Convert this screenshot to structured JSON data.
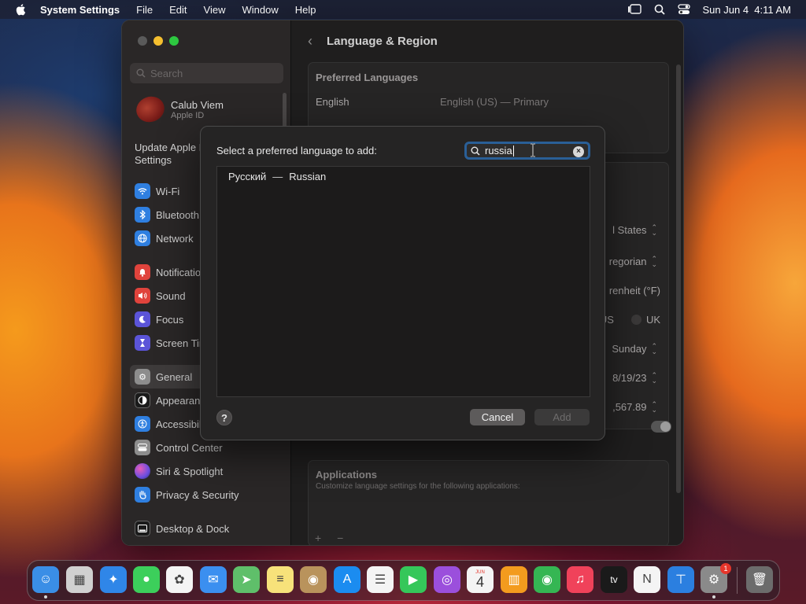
{
  "menubar": {
    "app_name": "System Settings",
    "items": [
      "File",
      "Edit",
      "View",
      "Window",
      "Help"
    ],
    "clock": "Sun Jun 4  4:11 AM"
  },
  "sidebar": {
    "search_placeholder": "Search",
    "profile": {
      "name": "Calub Viem",
      "subtitle": "Apple ID"
    },
    "update_text": "Update Apple ID Settings",
    "groups": [
      [
        {
          "label": "Wi-Fi",
          "icon": "wifi-icon",
          "color": "#2f7fe0"
        },
        {
          "label": "Bluetooth",
          "icon": "bluetooth-icon",
          "color": "#2f7fe0"
        },
        {
          "label": "Network",
          "icon": "globe-icon",
          "color": "#2f7fe0"
        }
      ],
      [
        {
          "label": "Notifications",
          "icon": "bell-icon",
          "color": "#e0433c"
        },
        {
          "label": "Sound",
          "icon": "speaker-icon",
          "color": "#e0433c"
        },
        {
          "label": "Focus",
          "icon": "moon-icon",
          "color": "#5b54d8"
        },
        {
          "label": "Screen Time",
          "icon": "hourglass-icon",
          "color": "#5b54d8"
        }
      ],
      [
        {
          "label": "General",
          "icon": "gear-icon",
          "color": "#8d8d8d",
          "selected": true
        },
        {
          "label": "Appearance",
          "icon": "appearance-icon",
          "color": "#1a1a1a"
        },
        {
          "label": "Accessibility",
          "icon": "accessibility-icon",
          "color": "#2f7fe0"
        },
        {
          "label": "Control Center",
          "icon": "control-center-icon",
          "color": "#8d8d8d"
        },
        {
          "label": "Siri & Spotlight",
          "icon": "siri-icon",
          "color": "#b44bd8"
        },
        {
          "label": "Privacy & Security",
          "icon": "hand-icon",
          "color": "#2f7fe0"
        }
      ],
      [
        {
          "label": "Desktop & Dock",
          "icon": "dock-icon",
          "color": "#1a1a1a"
        }
      ]
    ]
  },
  "main": {
    "title": "Language & Region",
    "preferred_languages": {
      "title": "Preferred Languages",
      "language": "English",
      "language_value": "English (US) — Primary"
    },
    "region_rows": [
      {
        "value": "l States",
        "control": "updown"
      },
      {
        "value": "regorian",
        "control": "updown"
      },
      {
        "value": "renheit (°F)",
        "control": "none"
      },
      {
        "value": "US",
        "control": "radio",
        "alt": "UK"
      },
      {
        "value": "Sunday",
        "control": "updown"
      },
      {
        "value": "8/19/23",
        "control": "updown"
      },
      {
        "value": ",567.89",
        "control": "updown"
      }
    ],
    "applications": {
      "title": "Applications",
      "subtitle": "Customize language settings for the following applications:",
      "add_remove": "+ −"
    }
  },
  "dialog": {
    "prompt": "Select a preferred language to add:",
    "search_value": "russia",
    "results": [
      {
        "native": "Русский",
        "english": "Russian",
        "separator": "—"
      }
    ],
    "help_label": "?",
    "cancel_label": "Cancel",
    "add_label": "Add"
  },
  "dock": {
    "items": [
      {
        "name": "finder",
        "color": "#3a8ee6",
        "glyph": "☺",
        "running": true
      },
      {
        "name": "launchpad",
        "color": "#d0d0d0",
        "glyph": "▦",
        "running": false
      },
      {
        "name": "safari",
        "color": "#2f86e8",
        "glyph": "✦",
        "running": false
      },
      {
        "name": "messages",
        "color": "#3ccf5b",
        "glyph": "●",
        "running": false
      },
      {
        "name": "photos",
        "color": "#f4f4f4",
        "glyph": "✿",
        "running": false
      },
      {
        "name": "mail",
        "color": "#3b8ff0",
        "glyph": "✉",
        "running": false
      },
      {
        "name": "maps",
        "color": "#5fbf6a",
        "glyph": "➤",
        "running": false
      },
      {
        "name": "notes",
        "color": "#f7e27a",
        "glyph": "≡",
        "running": false
      },
      {
        "name": "contacts",
        "color": "#b9935c",
        "glyph": "◉",
        "running": false
      },
      {
        "name": "app-store",
        "color": "#1b8cf0",
        "glyph": "A",
        "running": false
      },
      {
        "name": "reminders",
        "color": "#f4f4f4",
        "glyph": "☰",
        "running": false
      },
      {
        "name": "facetime",
        "color": "#35c75a",
        "glyph": "▶",
        "running": false
      },
      {
        "name": "podcasts",
        "color": "#9b4fdc",
        "glyph": "◎",
        "running": false
      },
      {
        "name": "calendar",
        "color": "#f4f4f4",
        "glyph": "4",
        "label_top": "JUN",
        "running": false
      },
      {
        "name": "books",
        "color": "#f39b1e",
        "glyph": "▥",
        "running": false
      },
      {
        "name": "find-my",
        "color": "#35b653",
        "glyph": "◉",
        "running": false
      },
      {
        "name": "music",
        "color": "#f0425a",
        "glyph": "♫",
        "running": false
      },
      {
        "name": "tv",
        "color": "#1a1a1a",
        "glyph": "tv",
        "running": false
      },
      {
        "name": "news",
        "color": "#f4f4f4",
        "glyph": "N",
        "running": false
      },
      {
        "name": "keynote",
        "color": "#2b7fe0",
        "glyph": "⊤",
        "running": false
      },
      {
        "name": "system-settings",
        "color": "#8a8a8a",
        "glyph": "⚙",
        "running": true,
        "badge": "1"
      },
      {
        "name": "trash",
        "color": "#6c6c6c",
        "glyph": "🗑",
        "running": false
      }
    ]
  }
}
